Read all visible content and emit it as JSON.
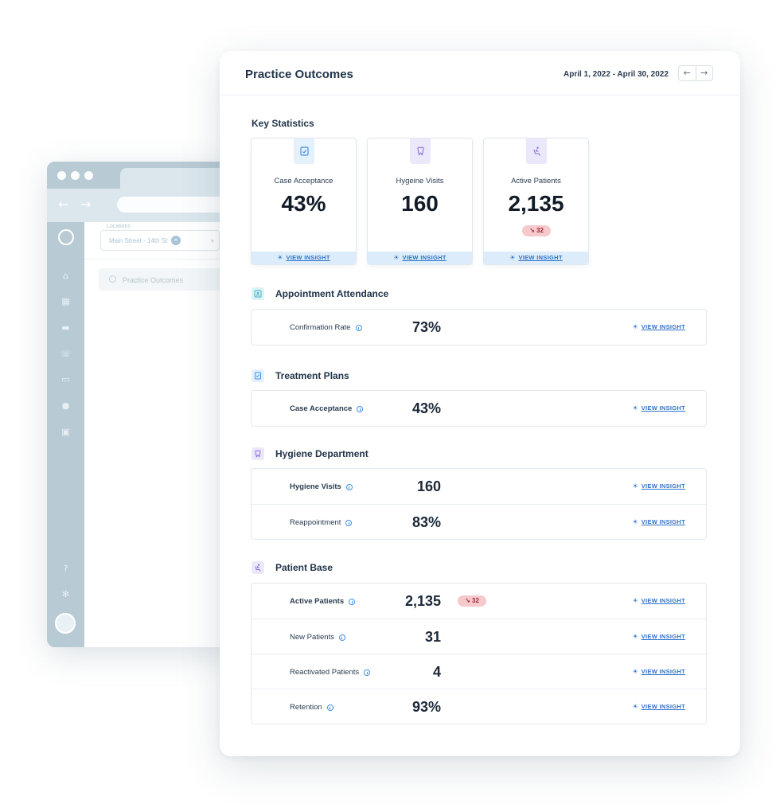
{
  "background_window": {
    "location_label": "Locations",
    "location_value": "Main Street - 14th St",
    "menu_item": "Practice Outcomes"
  },
  "header": {
    "title": "Practice Outcomes",
    "date_range": "April 1, 2022 - April 30, 2022",
    "prev_arrow": "←",
    "next_arrow": "→"
  },
  "key_statistics": {
    "heading": "Key Statistics",
    "insight_label": "VIEW INSIGHT",
    "tiles": [
      {
        "label": "Case Acceptance",
        "value": "43%",
        "icon": "document-icon",
        "icon_color": "#3f8fe6"
      },
      {
        "label": "Hygeine Visits",
        "value": "160",
        "icon": "tooth-icon",
        "icon_color": "#8a6fd6"
      },
      {
        "label": "Active Patients",
        "value": "2,135",
        "badge": "↘ 32",
        "icon": "patient-chair-icon",
        "icon_color": "#8a6fd6"
      }
    ]
  },
  "insight_label": "VIEW INSIGHT",
  "groups": [
    {
      "title": "Appointment Attendance",
      "icon": "id-card-icon",
      "icon_color": "#3fb3c7",
      "rows": [
        {
          "label": "Confirmation Rate",
          "value": "73%"
        }
      ]
    },
    {
      "title": "Treatment Plans",
      "icon": "document-icon",
      "icon_color": "#3f8fe6",
      "rows": [
        {
          "label": "Case Acceptance",
          "value": "43%"
        }
      ]
    },
    {
      "title": "Hygiene Department",
      "icon": "tooth-icon",
      "icon_color": "#8a6fd6",
      "rows": [
        {
          "label": "Hygiene Visits",
          "value": "160"
        },
        {
          "label": "Reappointment",
          "value": "83%"
        }
      ]
    },
    {
      "title": "Patient Base",
      "icon": "patient-chair-icon",
      "icon_color": "#8a6fd6",
      "rows": [
        {
          "label": "Active Patients",
          "value": "2,135",
          "badge": "↘ 32"
        },
        {
          "label": "New Patients",
          "value": "31"
        },
        {
          "label": "Reactivated Patients",
          "value": "4"
        },
        {
          "label": "Retention",
          "value": "93%"
        }
      ]
    }
  ]
}
